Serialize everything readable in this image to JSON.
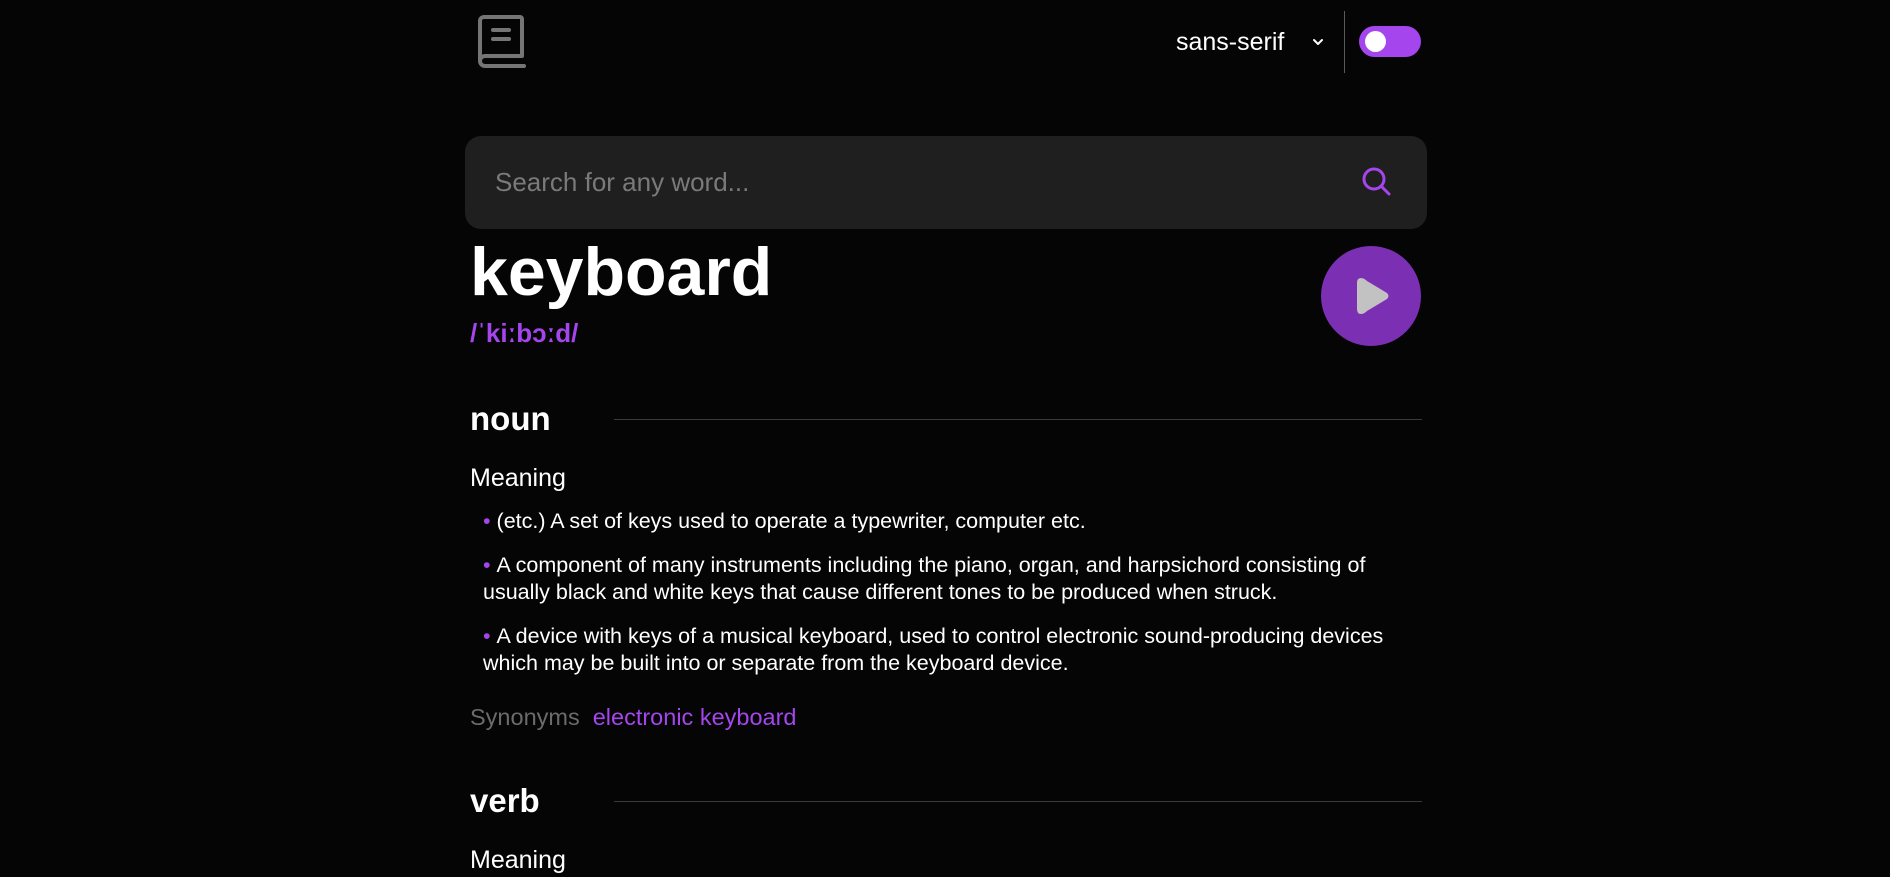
{
  "header": {
    "logo_icon": "book-icon",
    "font_selector": {
      "value": "sans-serif",
      "icon": "chevron-down-icon"
    },
    "theme_toggle": {
      "state": "on",
      "color": "#a445ed"
    }
  },
  "search": {
    "placeholder": "Search for any word...",
    "value": "",
    "icon": "search-icon"
  },
  "entry": {
    "word": "keyboard",
    "phonetic": "/ˈkiːbɔːd/",
    "play_icon": "play-icon",
    "meanings": [
      {
        "part_of_speech": "noun",
        "meaning_label": "Meaning",
        "definitions": [
          "(etc.) A set of keys used to operate a typewriter, computer etc.",
          "A component of many instruments including the piano, organ, and harpsichord consisting of usually black and white keys that cause different tones to be produced when struck.",
          "A device with keys of a musical keyboard, used to control electronic sound-producing devices which may be built into or separate from the keyboard device."
        ],
        "synonyms_label": "Synonyms",
        "synonyms": [
          "electronic keyboard"
        ]
      },
      {
        "part_of_speech": "verb",
        "meaning_label": "Meaning"
      }
    ]
  },
  "colors": {
    "accent": "#a445ed",
    "background": "#050505",
    "search_bg": "#1f1f1f"
  }
}
